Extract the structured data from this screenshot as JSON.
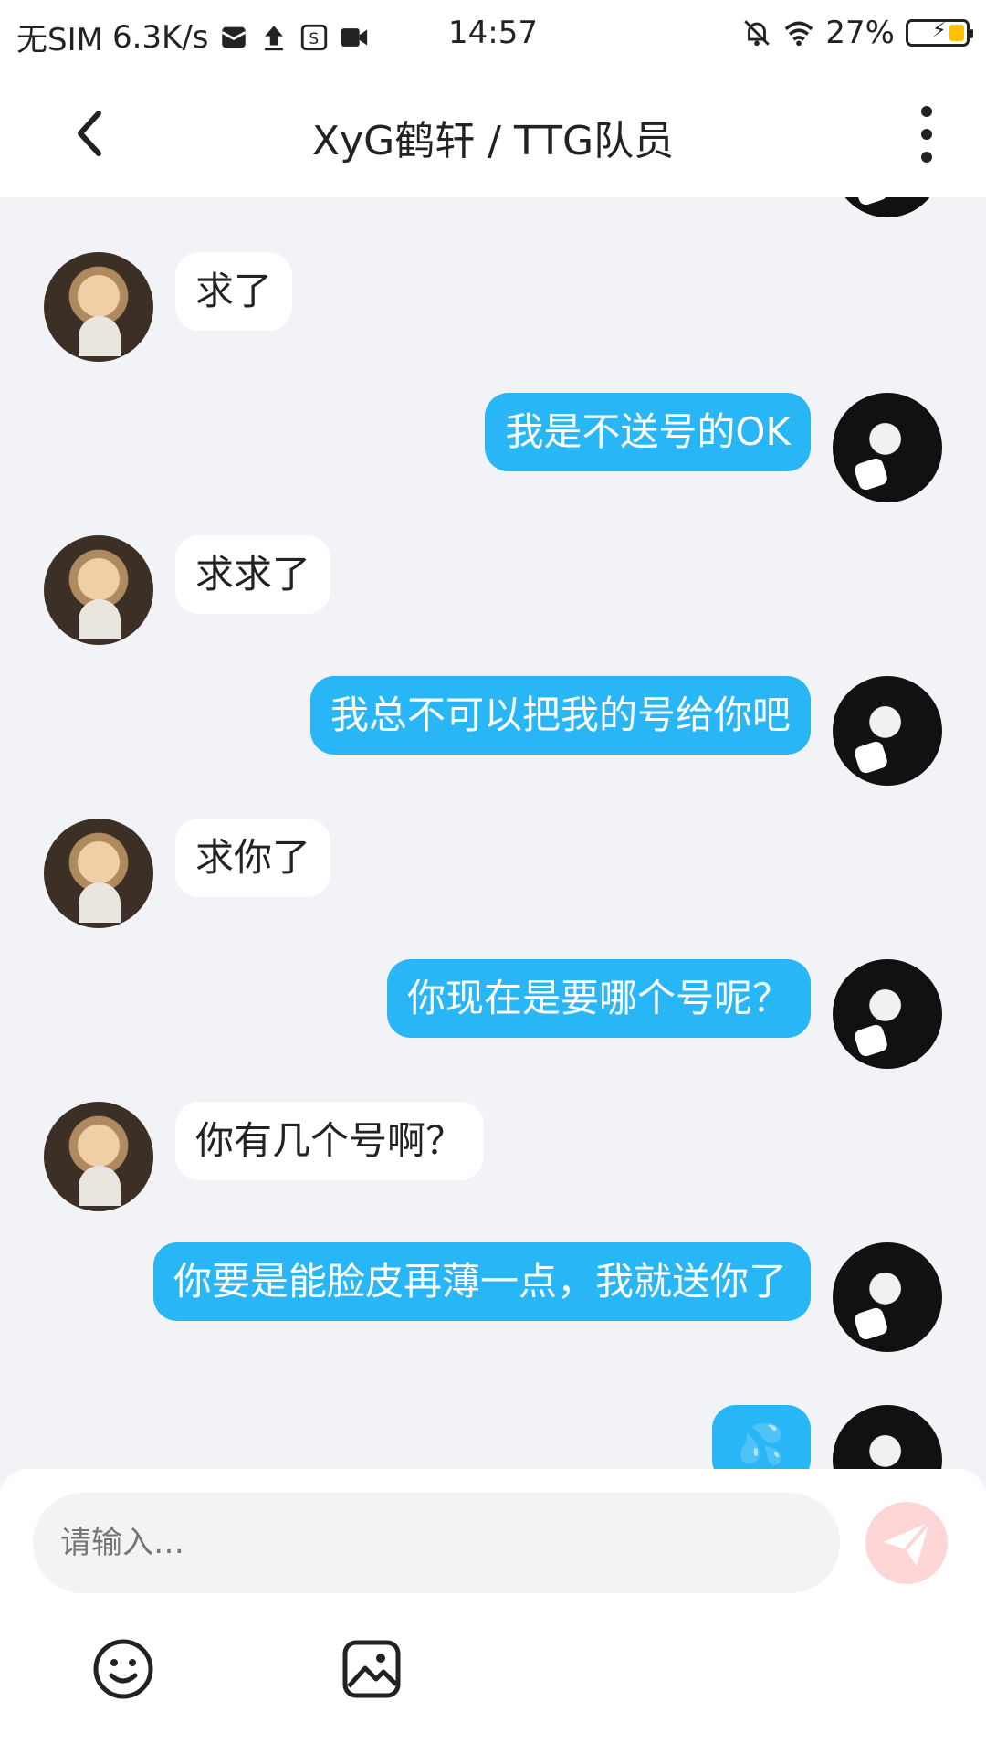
{
  "status_bar": {
    "carrier": "无SIM",
    "speed": "6.3K/s",
    "time": "14:57",
    "battery": "27%"
  },
  "header": {
    "title": "XyG鹤轩 / TTG队员"
  },
  "messages": [
    {
      "sender": "other",
      "text": "求了"
    },
    {
      "sender": "me",
      "text": "我是不送号的OK"
    },
    {
      "sender": "other",
      "text": "求求了"
    },
    {
      "sender": "me",
      "text": "我总不可以把我的号给你吧"
    },
    {
      "sender": "other",
      "text": "求你了"
    },
    {
      "sender": "me",
      "text": "你现在是要哪个号呢？"
    },
    {
      "sender": "other",
      "text": "你有几个号啊？"
    },
    {
      "sender": "me",
      "text": "你要是能脸皮再薄一点，我就送你了"
    },
    {
      "sender": "me",
      "text": "💦"
    }
  ],
  "input": {
    "placeholder": "请输入…"
  },
  "colors": {
    "accent": "#29b6f6",
    "background": "#f2f3f6",
    "send": "#ffd6d6"
  },
  "icons": [
    "back-arrow-icon",
    "more-vertical-icon",
    "emoji-icon",
    "image-icon",
    "send-icon"
  ]
}
